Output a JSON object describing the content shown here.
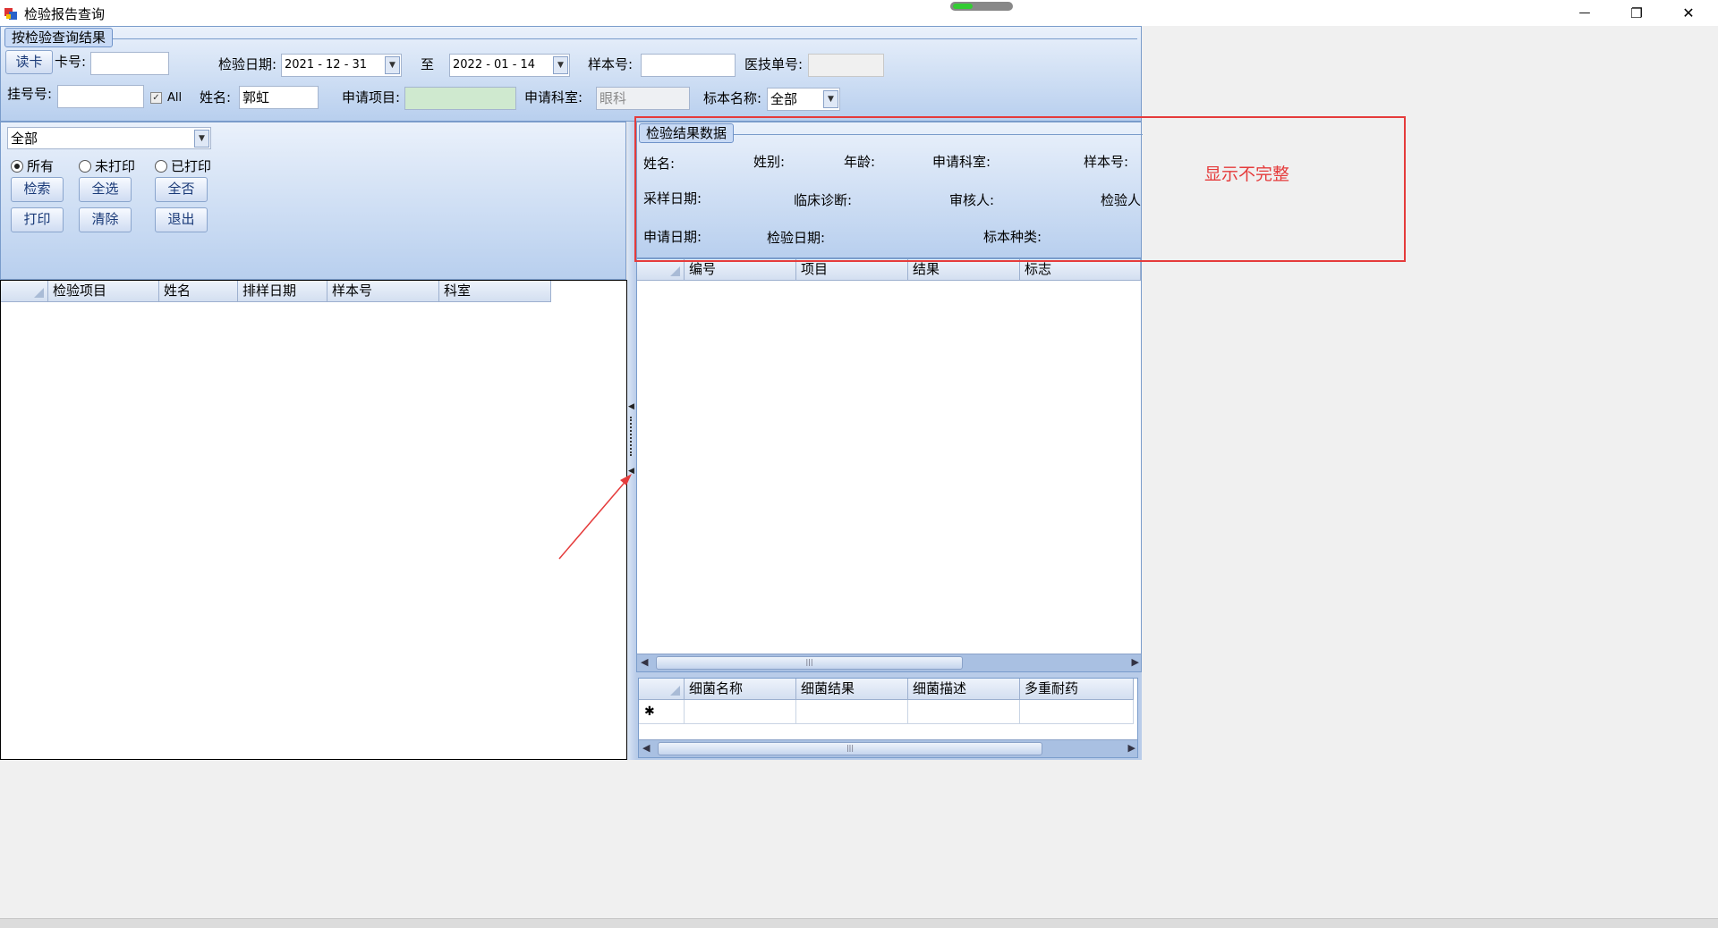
{
  "window": {
    "title": "检验报告查询",
    "minimize_glyph": "—",
    "restore_glyph": "❐",
    "close_glyph": "✕"
  },
  "query_group": {
    "caption": "按检验查询结果",
    "read_card_button": "读卡",
    "card_no_label": "卡号:",
    "card_no_value": "",
    "inspect_date_label": "检验日期:",
    "date_from": "2021 - 12 - 31",
    "to_label": "至",
    "date_to": "2022 - 01 - 14",
    "sample_no_label": "样本号:",
    "sample_no_value": "",
    "doctor_order_label": "医技单号:",
    "doctor_order_value": "",
    "reg_no_label": "挂号号:",
    "reg_no_value": "",
    "all_checkbox_label": "All",
    "name_label": "姓名:",
    "name_value": "郭虹",
    "apply_item_label": "申请项目:",
    "apply_item_value": "",
    "apply_dept_label": "申请科室:",
    "apply_dept_value": "眼科",
    "specimen_name_label": "标本名称:",
    "specimen_name_value": "全部"
  },
  "filter_panel": {
    "status_combo_value": "全部",
    "radios": [
      {
        "label": "所有",
        "checked": true
      },
      {
        "label": "未打印",
        "checked": false
      },
      {
        "label": "已打印",
        "checked": false
      }
    ],
    "buttons": {
      "search": "检索",
      "select_all": "全选",
      "select_none": "全否",
      "print": "打印",
      "clear": "清除",
      "exit": "退出"
    }
  },
  "left_grid": {
    "columns": [
      "检验项目",
      "姓名",
      "排样日期",
      "样本号",
      "科室"
    ],
    "rows": []
  },
  "result_group": {
    "caption": "检验结果数据",
    "fields": {
      "name": "姓名:",
      "gender": "姓别:",
      "age": "年龄:",
      "apply_dept": "申请科室:",
      "sample_no": "样本号:",
      "sampling_date": "采样日期:",
      "clinical_diagnosis": "临床诊断:",
      "reviewer": "审核人:",
      "inspector": "检验人",
      "apply_date": "申请日期:",
      "inspect_date": "检验日期:",
      "specimen_type": "标本种类:"
    }
  },
  "result_grid": {
    "columns": [
      "编号",
      "项目",
      "结果",
      "标志"
    ],
    "rows": []
  },
  "bacteria_grid": {
    "columns": [
      "细菌名称",
      "细菌结果",
      "细菌描述",
      "多重耐药"
    ],
    "new_row_marker": "✱"
  },
  "annotation": {
    "text": "显示不完整",
    "color": "#e53b3b"
  },
  "colors": {
    "panel_gradient_top": "#eaf1fb",
    "panel_gradient_bottom": "#b8cfee",
    "accent_border": "#7a9ccb"
  }
}
